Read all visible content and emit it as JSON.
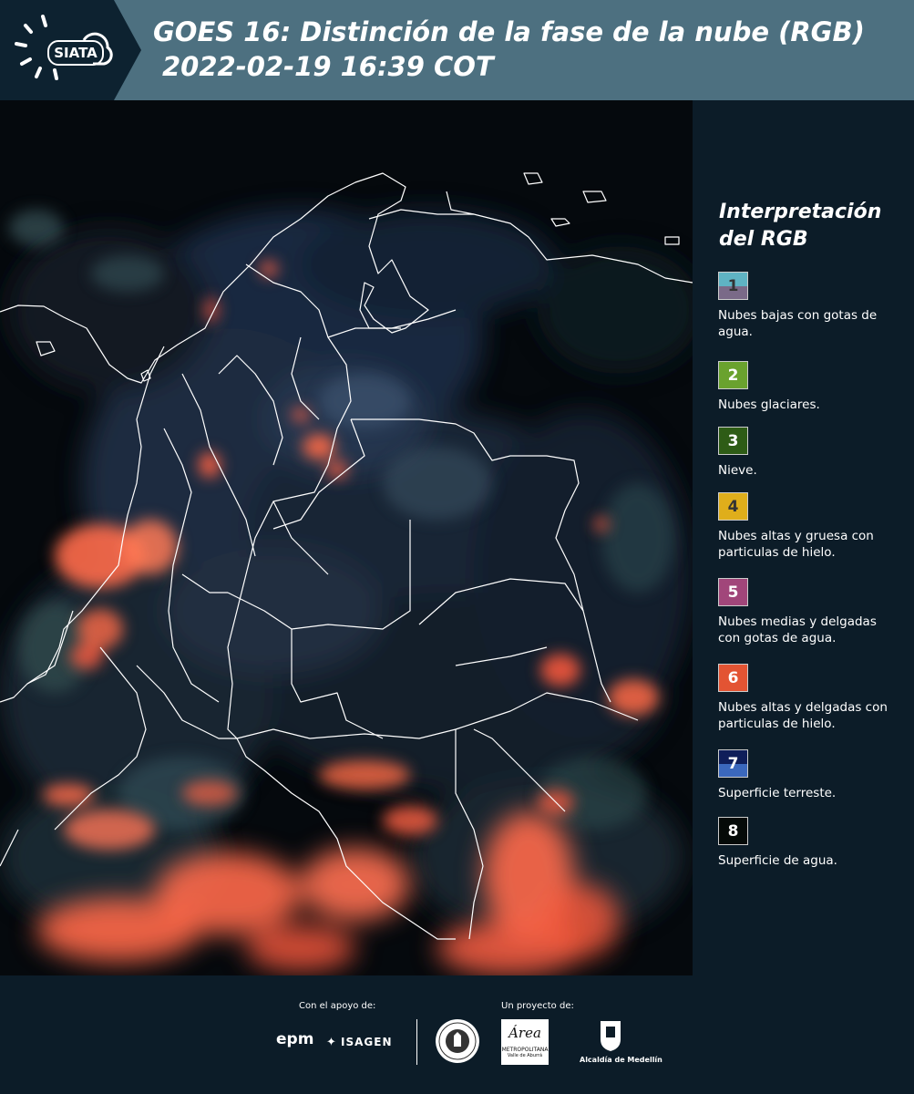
{
  "header": {
    "logo": "SIATA",
    "title_line1": "GOES 16: Distinción de la fase de la nube (RGB)",
    "title_line2": "2022-02-19 16:39 COT"
  },
  "legend": {
    "title": "Interpretación del RGB",
    "items": [
      {
        "num": "1",
        "label": "Nubes bajas con gotas de agua.",
        "color_top": "#5fb3c3",
        "color_bottom": "#7a6a88"
      },
      {
        "num": "2",
        "label": "Nubes glaciares.",
        "color": "#6aa22e"
      },
      {
        "num": "3",
        "label": "Nieve.",
        "color": "#2e5c16"
      },
      {
        "num": "4",
        "label": "Nubes altas y gruesa con particulas de hielo.",
        "color": "#dfae1b"
      },
      {
        "num": "5",
        "label": "Nubes medias y delgadas con gotas de agua.",
        "color": "#a1467a"
      },
      {
        "num": "6",
        "label": "Nubes altas y delgadas con particulas de hielo.",
        "color": "#e35433"
      },
      {
        "num": "7",
        "label": "Superficie terreste.",
        "color_top": "#0f1e5a",
        "color_bottom": "#3b68bd"
      },
      {
        "num": "8",
        "label": "Superficie de agua.",
        "color": "#050a08"
      }
    ]
  },
  "footer": {
    "support_label": "Con el apoyo de:",
    "project_label": "Un proyecto de:",
    "logo_epm": "epm",
    "logo_isagen": "ISAGEN",
    "logo_area_1": "Área",
    "logo_area_2": "METROPOLITANA",
    "logo_area_3": "Valle de Aburrá",
    "logo_alcaldia": "Alcaldía de Medellín"
  }
}
